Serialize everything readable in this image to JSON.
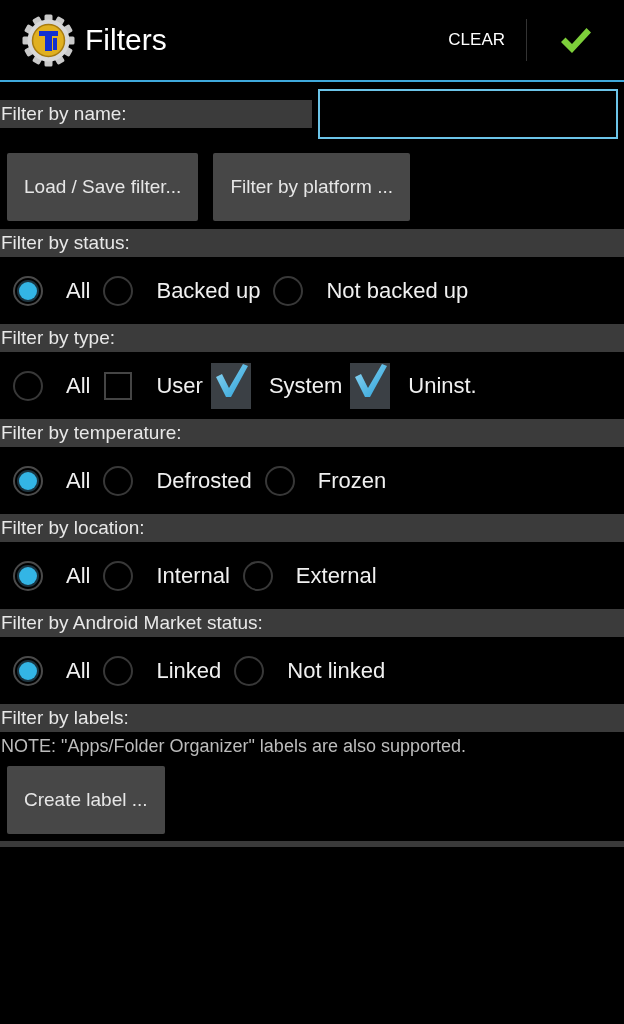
{
  "action_bar": {
    "title": "Filters",
    "clear_label": "CLEAR"
  },
  "name_filter": {
    "label": "Filter by name:"
  },
  "buttons": [
    "Load / Save filter...",
    "Filter by platform ..."
  ],
  "sections": [
    {
      "title": "Filter by status:",
      "options": [
        {
          "kind": "radio",
          "label": "All",
          "selected": true
        },
        {
          "kind": "radio",
          "label": "Backed up",
          "selected": false
        },
        {
          "kind": "radio",
          "label": "Not backed up",
          "selected": false
        }
      ]
    },
    {
      "title": "Filter by type:",
      "options": [
        {
          "kind": "radio",
          "label": "All",
          "selected": false
        },
        {
          "kind": "checkbox",
          "label": "User",
          "checked": false
        },
        {
          "kind": "checkbox",
          "label": "System",
          "checked": true
        },
        {
          "kind": "checkbox",
          "label": "Uninst.",
          "checked": true
        }
      ]
    },
    {
      "title": "Filter by temperature:",
      "options": [
        {
          "kind": "radio",
          "label": "All",
          "selected": true
        },
        {
          "kind": "radio",
          "label": "Defrosted",
          "selected": false
        },
        {
          "kind": "radio",
          "label": "Frozen",
          "selected": false
        }
      ]
    },
    {
      "title": "Filter by location:",
      "options": [
        {
          "kind": "radio",
          "label": "All",
          "selected": true
        },
        {
          "kind": "radio",
          "label": "Internal",
          "selected": false
        },
        {
          "kind": "radio",
          "label": "External",
          "selected": false
        }
      ]
    },
    {
      "title": "Filter by Android Market status:",
      "options": [
        {
          "kind": "radio",
          "label": "All",
          "selected": true
        },
        {
          "kind": "radio",
          "label": "Linked",
          "selected": false
        },
        {
          "kind": "radio",
          "label": "Not linked",
          "selected": false
        }
      ]
    },
    {
      "title": "Filter by labels:",
      "note": "NOTE: \"Apps/Folder Organizer\" labels are also supported.",
      "button": "Create label ..."
    }
  ]
}
